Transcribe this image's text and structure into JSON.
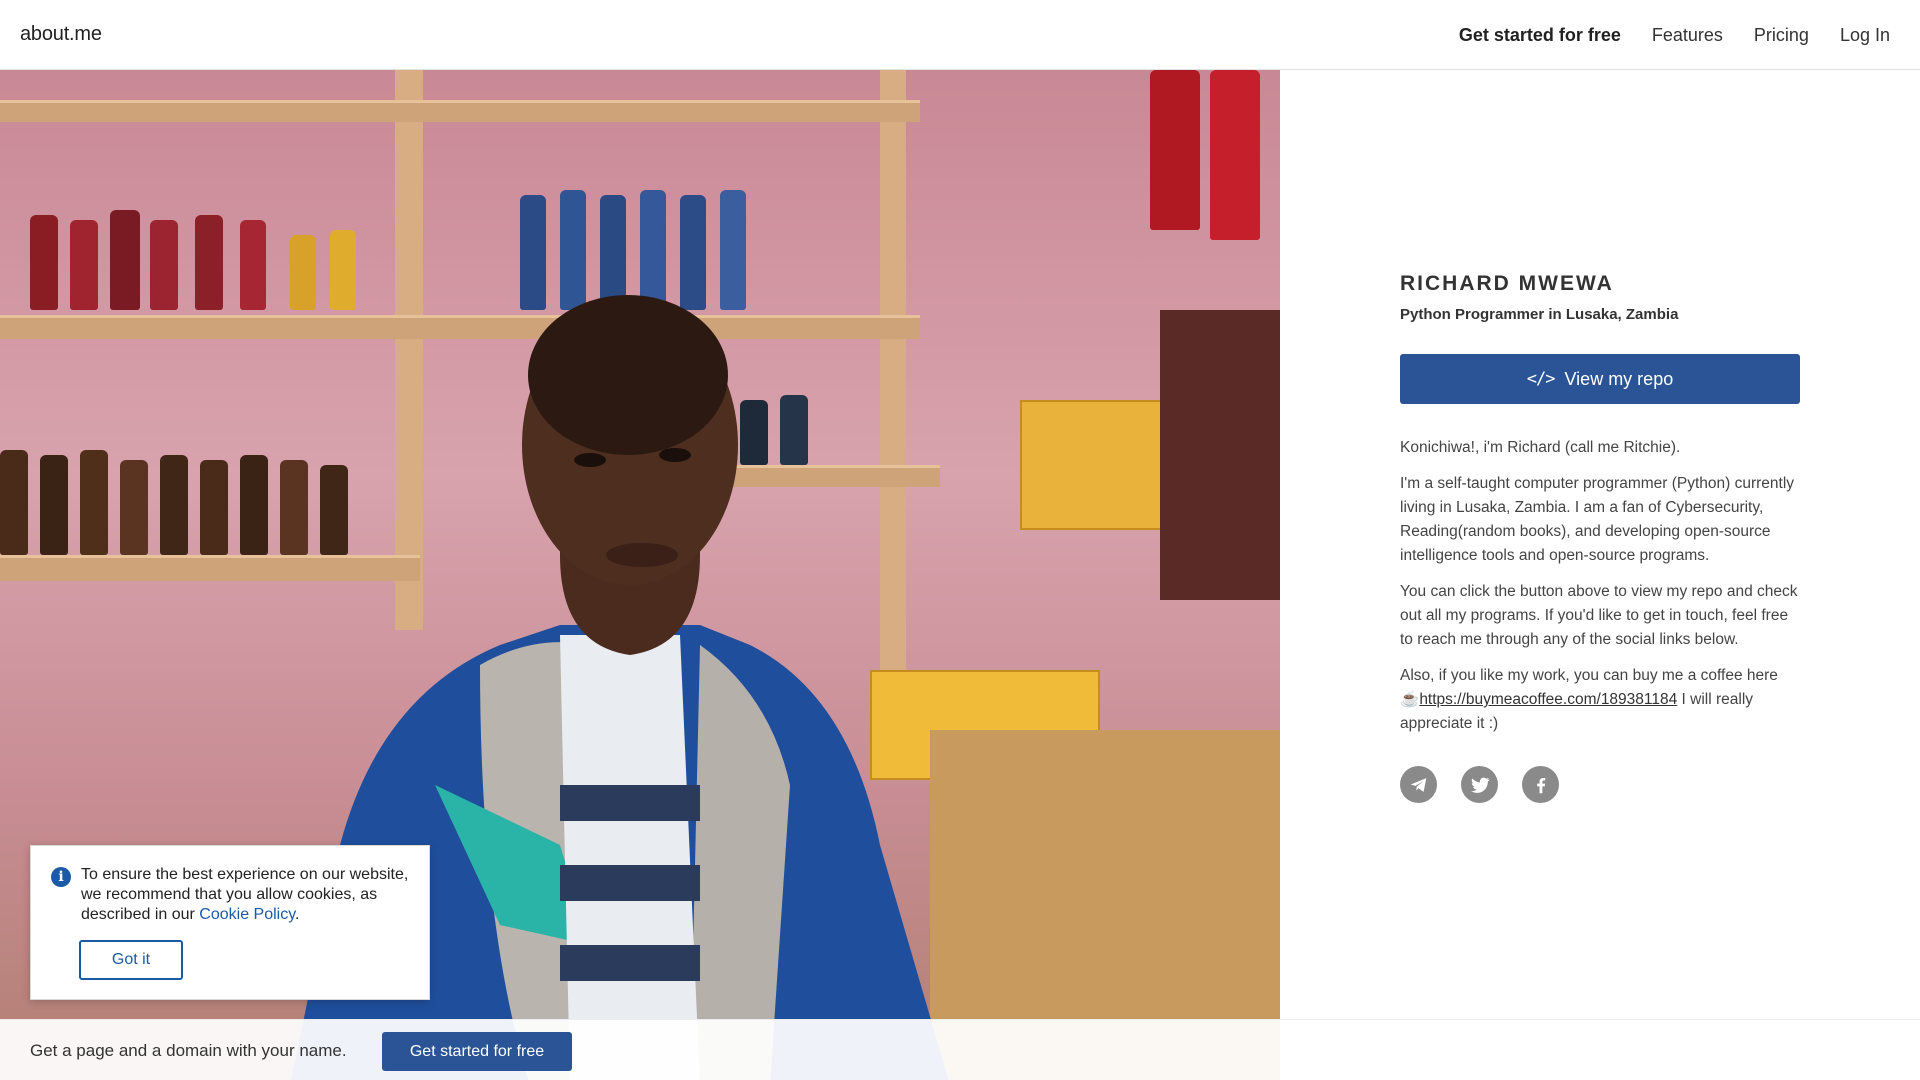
{
  "header": {
    "logo": "about.me",
    "nav": {
      "get_started": "Get started for free",
      "features": "Features",
      "pricing": "Pricing",
      "login": "Log In"
    }
  },
  "profile": {
    "name": "RICHARD MWEWA",
    "headline": "Python Programmer in Lusaka, Zambia",
    "button_icon": "code-icon",
    "button_icon_glyph": "</>",
    "button_label": "View my repo",
    "bio": {
      "p1": "Konichiwa!, i'm Richard (call me Ritchie).",
      "p2": "I'm a self-taught computer programmer (Python) currently living in Lusaka, Zambia. I am a fan of Cybersecurity, Reading(random books), and developing open-source intelligence tools and open-source programs.",
      "p3": "You can click the button above to view my repo and check out all my programs. If you'd like to get in touch, feel free to reach me through any of the social links below.",
      "p4_before": "Also, if you like my work, you can buy me a coffee here ☕️",
      "p4_link": "https://buymeacoffee.com/189381184",
      "p4_after": " I will really appreciate it :)"
    },
    "social": [
      "telegram-icon",
      "twitter-icon",
      "facebook-icon"
    ]
  },
  "cookie_banner": {
    "icon": "info-icon",
    "text": "To ensure the best experience on our website, we recommend that you allow cookies, as described in our ",
    "link": "Cookie Policy",
    "text_end": ".",
    "button": "Got it"
  },
  "bottom_bar": {
    "text": "Get a page and a domain with your name.",
    "cta": "Get started for free"
  },
  "colors": {
    "accent": "#2a5495",
    "link": "#1b5aa6",
    "icon_gray": "#8a8a8a"
  }
}
